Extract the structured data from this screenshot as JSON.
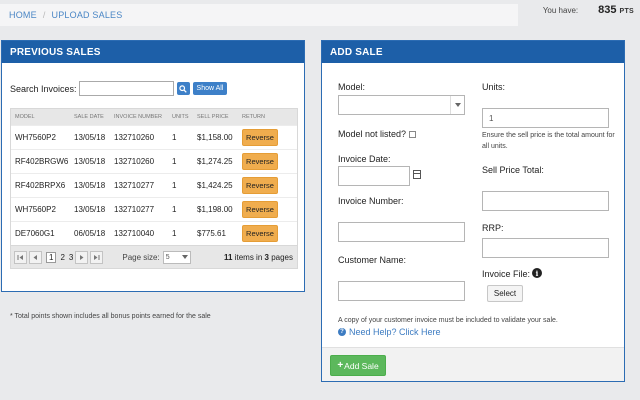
{
  "breadcrumb": {
    "home": "HOME",
    "sep": "/",
    "current": "UPLOAD SALES"
  },
  "points": {
    "label": "You have:",
    "value": "835",
    "unit": "PTS"
  },
  "previous_sales": {
    "title": "PREVIOUS SALES",
    "search_label": "Search Invoices:",
    "search_value": "",
    "show_all": "Show All",
    "columns": [
      "MODEL",
      "SALE DATE",
      "INVOICE NUMBER",
      "UNITS",
      "SELL PRICE",
      "RETURN"
    ],
    "rows": [
      {
        "model": "WH7560P2",
        "date": "13/05/18",
        "invoice": "132710260",
        "units": "1",
        "price": "$1,158.00",
        "action": "Reverse"
      },
      {
        "model": "RF402BRGW6",
        "date": "13/05/18",
        "invoice": "132710260",
        "units": "1",
        "price": "$1,274.25",
        "action": "Reverse"
      },
      {
        "model": "RF402BRPX6",
        "date": "13/05/18",
        "invoice": "132710277",
        "units": "1",
        "price": "$1,424.25",
        "action": "Reverse"
      },
      {
        "model": "WH7560P2",
        "date": "13/05/18",
        "invoice": "132710277",
        "units": "1",
        "price": "$1,198.00",
        "action": "Reverse"
      },
      {
        "model": "DE7060G1",
        "date": "06/05/18",
        "invoice": "132710040",
        "units": "1",
        "price": "$775.61",
        "action": "Reverse"
      }
    ],
    "pager": {
      "pages": [
        "1",
        "2",
        "3"
      ],
      "page_size_label": "Page size:",
      "page_size": "5",
      "count": "11",
      "items_in": "items in",
      "pages_count": "3",
      "pages_word": "pages"
    },
    "note": "* Total points shown includes all bonus points earned for the sale"
  },
  "add_sale": {
    "title": "ADD SALE",
    "model_label": "Model:",
    "model_value": "",
    "units_label": "Units:",
    "units_value": "1",
    "units_hint": "Ensure the sell price is the total amount for all units.",
    "not_listed_label": "Model not listed?",
    "invoice_date_label": "Invoice Date:",
    "invoice_date_value": "",
    "sell_total_label": "Sell Price Total:",
    "sell_total_value": "",
    "invoice_number_label": "Invoice Number:",
    "invoice_number_value": "",
    "rrp_label": "RRP:",
    "rrp_value": "",
    "customer_label": "Customer Name:",
    "customer_value": "",
    "invoice_file_label": "Invoice File:",
    "select_btn": "Select",
    "copy_note": "A copy of your customer invoice must be included to validate your sale.",
    "help": "Need Help? Click Here",
    "submit": "Add Sale"
  },
  "colors": {
    "header_blue": "#1d5fa8",
    "link_blue": "#4a86c5",
    "reverse_orange": "#f0ad4e",
    "add_green": "#5cb85c"
  }
}
